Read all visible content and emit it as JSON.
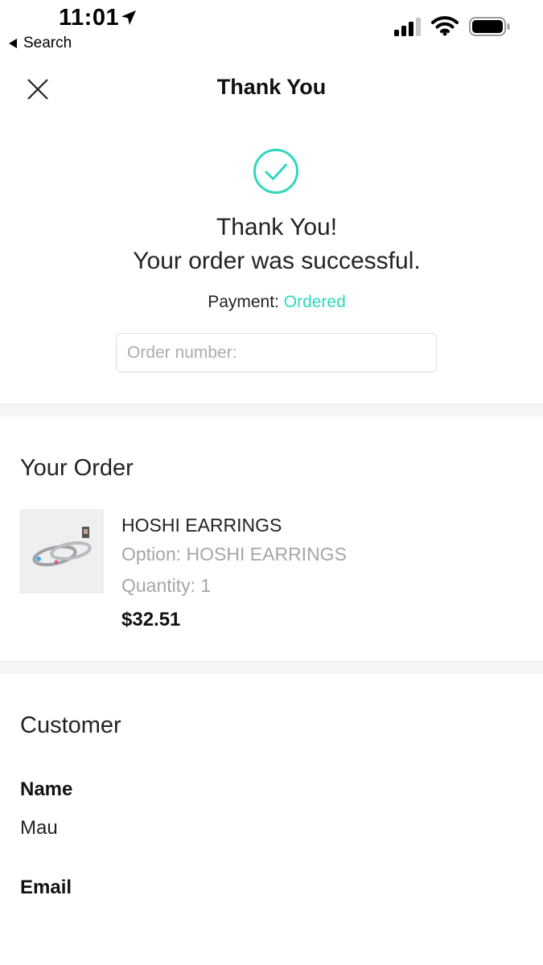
{
  "status_bar": {
    "time": "11:01",
    "back_label": "Search",
    "icons": [
      "location-arrow-icon",
      "signal-icon",
      "wifi-icon",
      "battery-icon"
    ]
  },
  "header": {
    "title": "Thank You",
    "close_icon": "close-icon"
  },
  "success": {
    "icon": "check-circle-icon",
    "line1": "Thank You!",
    "line2": "Your order was successful.",
    "payment_label": "Payment:",
    "payment_status": "Ordered",
    "order_number_placeholder": "Order number:"
  },
  "order": {
    "section_title": "Your Order",
    "items": [
      {
        "name": "HOSHI EARRINGS",
        "option": "Option: HOSHI EARRINGS",
        "quantity": "Quantity: 1",
        "price": "$32.51"
      }
    ]
  },
  "customer": {
    "section_title": "Customer",
    "name_label": "Name",
    "name_value": "Mau",
    "email_label": "Email"
  },
  "colors": {
    "accent": "#2fd7c0",
    "muted_text": "#a3a6ab",
    "divider": "#f5f6f8"
  }
}
